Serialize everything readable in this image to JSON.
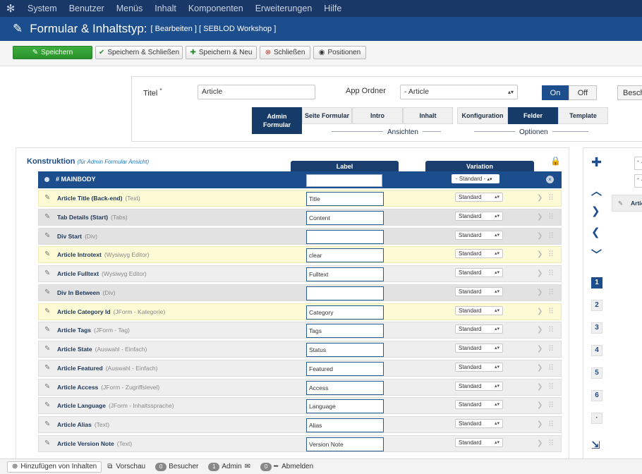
{
  "topmenu": [
    "System",
    "Benutzer",
    "Menüs",
    "Inhalt",
    "Komponenten",
    "Erweiterungen",
    "Hilfe"
  ],
  "titlebar": {
    "title": "Formular & Inhaltstyp:",
    "subtitle": "[ Bearbeiten ] [ SEBLOD Workshop ]"
  },
  "toolbar": {
    "save": "Speichern",
    "save_close": "Speichern & Schließen",
    "save_new": "Speichern & Neu",
    "close": "Schließen",
    "positions": "Positionen"
  },
  "header": {
    "title_label": "Titel",
    "required_mark": "*",
    "title_value": "Article",
    "folder_label": "App Ordner",
    "folder_value": "- Article",
    "on_label": "On",
    "off_label": "Off",
    "extra_button": "Besch",
    "admin_tab": [
      "Admin",
      "Formular"
    ],
    "views": [
      "Seite Formular",
      "Intro",
      "Inhalt"
    ],
    "views_label": "Ansichten",
    "options": [
      "Konfiguration",
      "Felder",
      "Template"
    ],
    "options_label": "Optionen"
  },
  "construction": {
    "title": "Konstruktion",
    "subtitle": "(für Admin Formular Ansicht)",
    "col_label": "Label",
    "col_variation": "Variation",
    "position_name": "# MAINBODY",
    "position_variation": "- Standard -",
    "fields": [
      {
        "name": "Article Title (Back-end)",
        "type": "(Text)",
        "label": "Title",
        "variation": "Standard",
        "style": "hl"
      },
      {
        "name": "Tab Details (Start)",
        "type": "(Tabs)",
        "label": "Content",
        "variation": "Standard",
        "style": "alt"
      },
      {
        "name": "Div Start",
        "type": "(Div)",
        "label": "",
        "variation": "Standard",
        "style": "alt"
      },
      {
        "name": "Article Introtext",
        "type": "(Wysiwyg Editor)",
        "label": "clear",
        "variation": "Standard",
        "style": "hl"
      },
      {
        "name": "Article Fulltext",
        "type": "(Wysiwyg Editor)",
        "label": "Fulltext",
        "variation": "Standard",
        "style": "plain"
      },
      {
        "name": "Div In Between",
        "type": "(Div)",
        "label": "",
        "variation": "Standard",
        "style": "alt"
      },
      {
        "name": "Article Category Id",
        "type": "(JForm - Kategorie)",
        "label": "Category",
        "variation": "Standard",
        "style": "hl"
      },
      {
        "name": "Article Tags",
        "type": "(JForm - Tag)",
        "label": "Tags",
        "variation": "Standard",
        "style": "plain"
      },
      {
        "name": "Article State",
        "type": "(Auswahl - Einfach)",
        "label": "Status",
        "variation": "Standard",
        "style": "plain"
      },
      {
        "name": "Article Featured",
        "type": "(Auswahl - Einfach)",
        "label": "Featured",
        "variation": "Standard",
        "style": "plain"
      },
      {
        "name": "Article Access",
        "type": "(JForm - Zugriffslevel)",
        "label": "Access",
        "variation": "Standard",
        "style": "plain"
      },
      {
        "name": "Article Language",
        "type": "(JForm - Inhaltssprache)",
        "label": "Language",
        "variation": "Standard",
        "style": "plain"
      },
      {
        "name": "Article Alias",
        "type": "(Text)",
        "label": "Alias",
        "variation": "Standard",
        "style": "plain"
      },
      {
        "name": "Article Version Note",
        "type": "(Text)",
        "label": "Version Note",
        "variation": "Standard",
        "style": "plain"
      }
    ]
  },
  "sidebar": {
    "pages": [
      "1",
      "2",
      "3",
      "4",
      "5",
      "6",
      "·"
    ],
    "select_a": "- .",
    "select_b": "- .",
    "field_preview": "Artic"
  },
  "statusbar": {
    "add_content": "Hinzufügen von Inhalten",
    "preview": "Vorschau",
    "visitors_count": "0",
    "visitors": "Besucher",
    "admin_count": "1",
    "admin": "Admin",
    "messages_count": "0",
    "logout": "Abmelden"
  },
  "colors": {
    "topbar": "#1a3867",
    "titlebar": "#1c4d8c",
    "primary": "#2c922c",
    "highlight_row": "#fcfbd6"
  }
}
